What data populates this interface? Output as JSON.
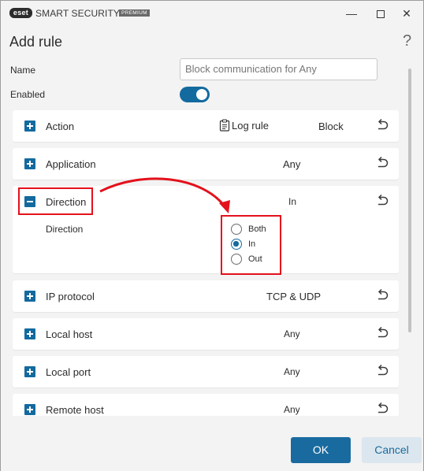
{
  "titlebar": {
    "logo_text": "eset",
    "product_name": "SMART SECURITY",
    "edition": "PREMIUM",
    "minimize_glyph": "—",
    "close_glyph": "✕"
  },
  "dialog": {
    "title": "Add rule",
    "help_glyph": "?"
  },
  "form": {
    "name_label": "Name",
    "name_value": "Block communication for Any",
    "enabled_label": "Enabled",
    "enabled": true
  },
  "rules": {
    "action": {
      "label": "Action",
      "log_rule": "Log rule",
      "value": "Block"
    },
    "application": {
      "label": "Application",
      "value": "Any"
    },
    "direction": {
      "label": "Direction",
      "value": "In",
      "sub_label": "Direction",
      "options": [
        "Both",
        "In",
        "Out"
      ],
      "selected": "In"
    },
    "ip_protocol": {
      "label": "IP protocol",
      "value": "TCP & UDP"
    },
    "local_host": {
      "label": "Local host",
      "value": "Any"
    },
    "local_port": {
      "label": "Local port",
      "value": "Any"
    },
    "remote_host": {
      "label": "Remote host",
      "value": "Any"
    }
  },
  "footer": {
    "ok_label": "OK",
    "cancel_label": "Cancel"
  },
  "colors": {
    "accent": "#136a9e",
    "annotation": "#e3111b",
    "background": "#f3f3f3"
  },
  "icons": {
    "expand": "plus-box-icon",
    "collapse": "minus-box-icon",
    "reset": "undo-arrow-icon",
    "log": "clipboard-icon"
  }
}
